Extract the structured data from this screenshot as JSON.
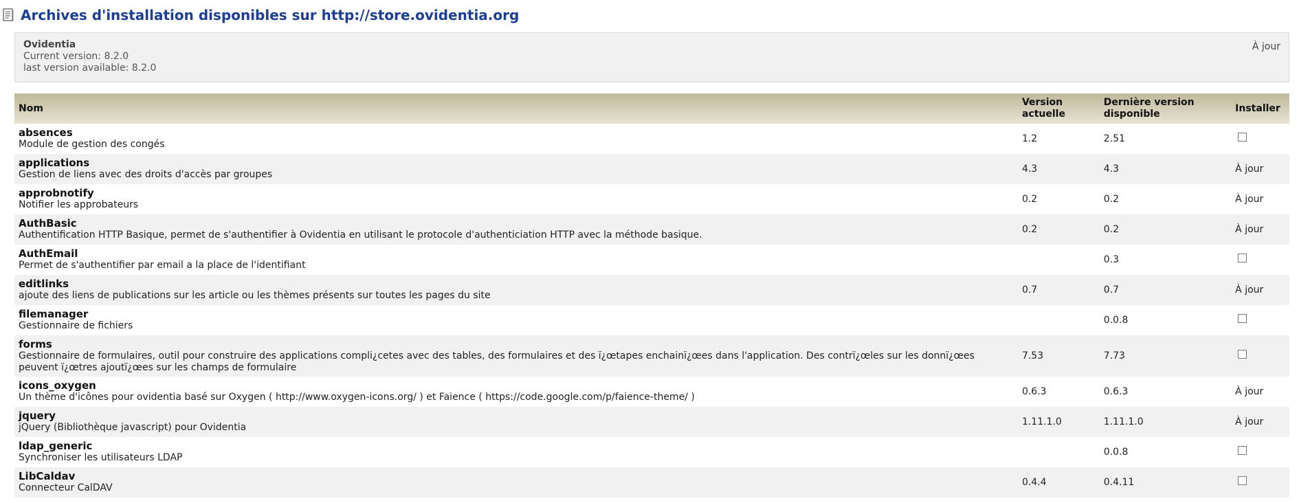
{
  "header": {
    "title": "Archives d'installation disponibles sur http://store.ovidentia.org"
  },
  "core": {
    "name": "Ovidentia",
    "current_version": "Current version: 8.2.0",
    "last_version": "last version available: 8.2.0",
    "status": "À jour"
  },
  "table": {
    "headers": {
      "name": "Nom",
      "current": "Version actuelle",
      "latest": "Dernière version disponible",
      "install": "Installer"
    },
    "rows": [
      {
        "name": "absences",
        "desc": "Module de gestion des congés",
        "current": "1.2",
        "latest": "2.51",
        "install": "checkbox"
      },
      {
        "name": "applications",
        "desc": "Gestion de liens avec des droits d'accès par groupes",
        "current": "4.3",
        "latest": "4.3",
        "install": "À jour"
      },
      {
        "name": "approbnotify",
        "desc": "Notifier les approbateurs",
        "current": "0.2",
        "latest": "0.2",
        "install": "À jour"
      },
      {
        "name": "AuthBasic",
        "desc": "Authentification HTTP Basique, permet de s'authentifier à Ovidentia en utilisant le protocole d'authenticiation HTTP avec la méthode basique.",
        "current": "0.2",
        "latest": "0.2",
        "install": "À jour"
      },
      {
        "name": "AuthEmail",
        "desc": "Permet de s'authentifier par email a la place de l'identifiant",
        "current": "",
        "latest": "0.3",
        "install": "checkbox"
      },
      {
        "name": "editlinks",
        "desc": "ajoute des liens de publications sur les article ou les thèmes présents sur toutes les pages du site",
        "current": "0.7",
        "latest": "0.7",
        "install": "À jour"
      },
      {
        "name": "filemanager",
        "desc": "Gestionnaire de fichiers",
        "current": "",
        "latest": "0.0.8",
        "install": "checkbox"
      },
      {
        "name": "forms",
        "desc": "Gestionnaire de formulaires, outil pour construire des applications compli¿cetes avec des tables, des formulaires et des ï¿œtapes enchainï¿œes dans l'application. Des contrï¿œles sur les donnï¿œes peuvent ï¿œtres ajoutï¿œes sur les champs de formulaire",
        "current": "7.53",
        "latest": "7.73",
        "install": "checkbox"
      },
      {
        "name": "icons_oxygen",
        "desc": "Un thème d'icônes pour ovidentia basé sur Oxygen ( http://www.oxygen-icons.org/ ) et Faience ( https://code.google.com/p/faience-theme/ )",
        "current": "0.6.3",
        "latest": "0.6.3",
        "install": "À jour"
      },
      {
        "name": "jquery",
        "desc": "jQuery (Bibliothèque javascript) pour Ovidentia",
        "current": "1.11.1.0",
        "latest": "1.11.1.0",
        "install": "À jour"
      },
      {
        "name": "ldap_generic",
        "desc": "Synchroniser les utilisateurs LDAP",
        "current": "",
        "latest": "0.0.8",
        "install": "checkbox"
      },
      {
        "name": "LibCaldav",
        "desc": "Connecteur CalDAV",
        "current": "0.4.4",
        "latest": "0.4.11",
        "install": "checkbox"
      }
    ]
  }
}
